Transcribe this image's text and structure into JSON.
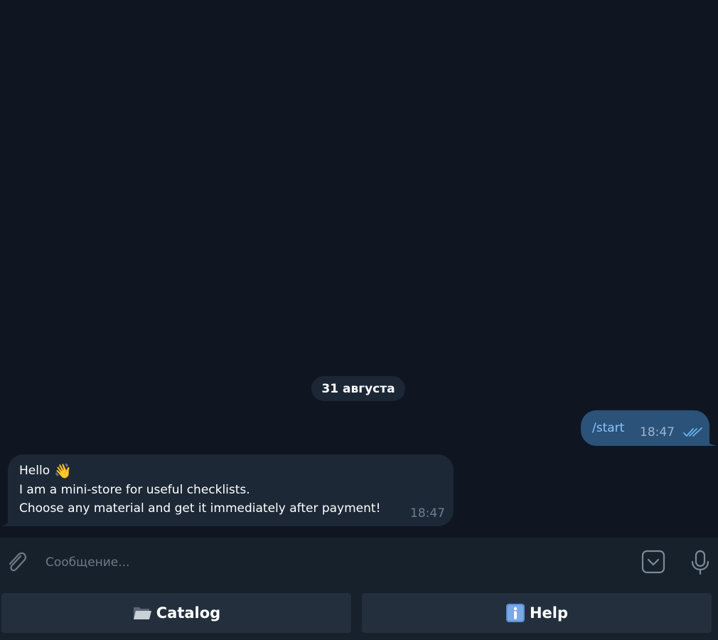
{
  "chat": {
    "date_separator": "31 августа",
    "messages": [
      {
        "direction": "outgoing",
        "text": "/start",
        "time": "18:47",
        "status": "read"
      },
      {
        "direction": "incoming",
        "lines": [
          "Hello",
          "I am a mini-store for useful checklists.",
          "Choose any material and get it immediately after payment!"
        ],
        "emoji": "👋",
        "time": "18:47"
      }
    ]
  },
  "composer": {
    "placeholder": "Сообщение...",
    "value": ""
  },
  "reply_keyboard": {
    "buttons": [
      {
        "label": "Catalog",
        "icon": "folder-icon"
      },
      {
        "label": "Help",
        "icon": "info-icon"
      }
    ]
  },
  "colors": {
    "background": "#0f1621",
    "outgoing_bubble": "#2b5278",
    "incoming_bubble": "#1c2836",
    "panel": "#17212b",
    "keyboard_button": "#232f3d",
    "accent": "#8cc4ff"
  }
}
